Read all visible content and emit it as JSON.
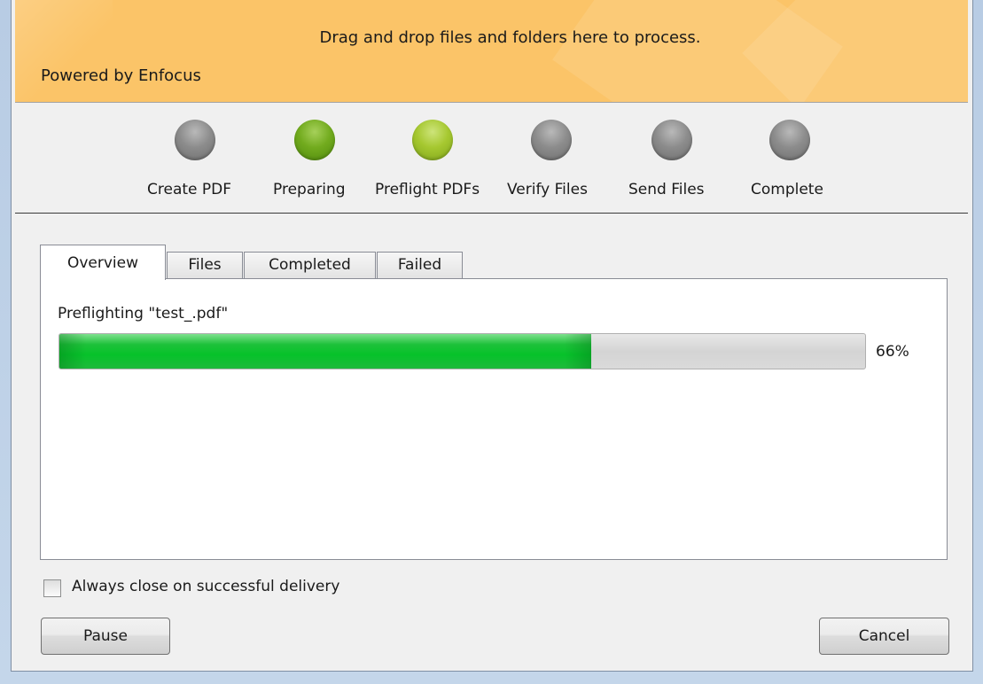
{
  "banner": {
    "drop_text": "Drag and drop files and folders here to process.",
    "powered_by": "Powered by Enfocus",
    "color": "#fbc468"
  },
  "steps": [
    {
      "label": "Create PDF",
      "state": "pending",
      "color": "#8c8c8c"
    },
    {
      "label": "Preparing",
      "state": "done",
      "color": "#72ab1e"
    },
    {
      "label": "Preflight PDFs",
      "state": "active",
      "color": "#a6c830"
    },
    {
      "label": "Verify Files",
      "state": "pending",
      "color": "#8c8c8c"
    },
    {
      "label": "Send Files",
      "state": "pending",
      "color": "#8c8c8c"
    },
    {
      "label": "Complete",
      "state": "pending",
      "color": "#8c8c8c"
    }
  ],
  "tabs": [
    {
      "label": "Overview",
      "selected": true
    },
    {
      "label": "Files",
      "selected": false
    },
    {
      "label": "Completed",
      "selected": false
    },
    {
      "label": "Failed",
      "selected": false
    }
  ],
  "overview": {
    "status_text": "Preflighting \"test_.pdf\"",
    "progress_value": 66,
    "progress_label": "66%",
    "progress_color": "#06c22a"
  },
  "options": {
    "always_close_label": "Always close on successful delivery",
    "always_close_checked": false
  },
  "buttons": {
    "pause_label": "Pause",
    "cancel_label": "Cancel"
  }
}
